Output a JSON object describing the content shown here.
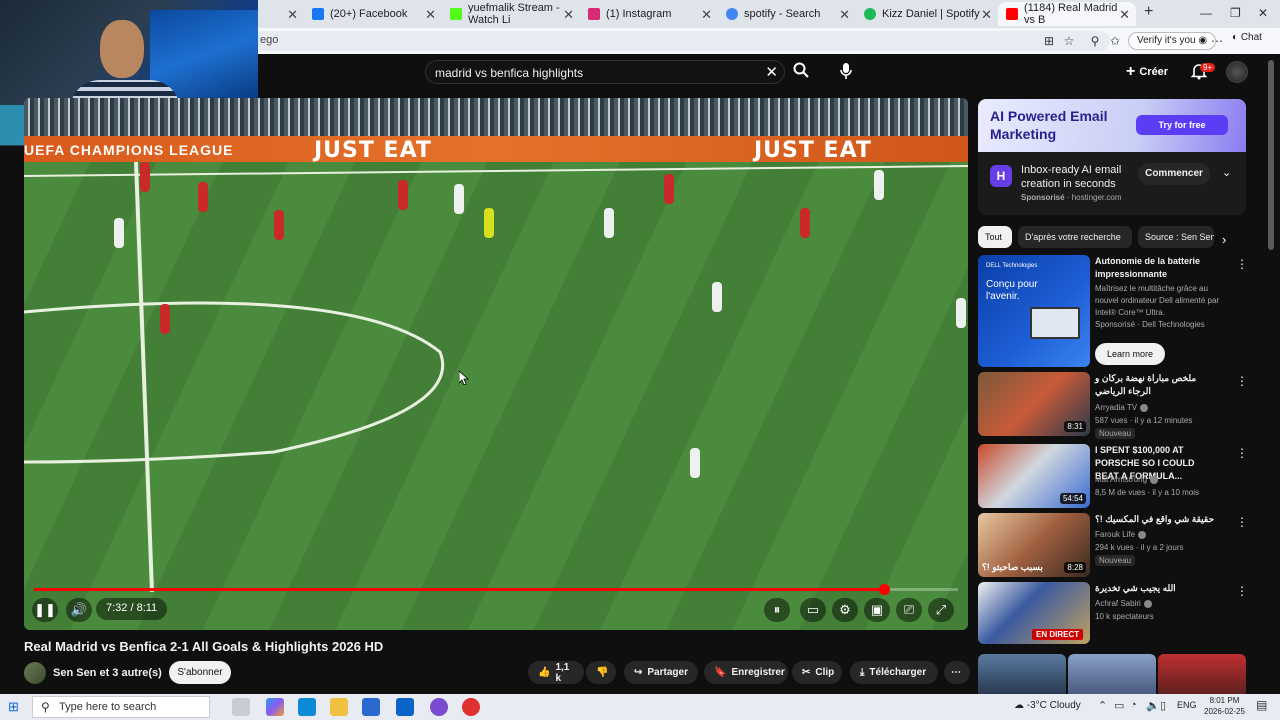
{
  "browser": {
    "tabs": [
      {
        "label": "(20+) Facebook",
        "fav": "#1877f2"
      },
      {
        "label": "yuefmalik Stream - Watch Li",
        "fav": "#53fc18"
      },
      {
        "label": "(1) Instagram",
        "fav": "#d62976"
      },
      {
        "label": "spotify - Search",
        "fav": "#4285f4"
      },
      {
        "label": "Kizz Daniel | Spotify",
        "fav": "#1db954"
      },
      {
        "label": "(1184) Real Madrid vs B",
        "fav": "#ff0000"
      }
    ],
    "url": "ego",
    "verify_label": "Verify it's you",
    "chat_label": "Chat",
    "new_tab": "+"
  },
  "youtube": {
    "search_value": "madrid vs benfica highlights",
    "create_label": "Créer",
    "notif_count": "9+"
  },
  "player": {
    "board_left": "UEFA CHAMPIONS LEAGUE",
    "board_ads": [
      "JUST EAT",
      "JUST EAT"
    ],
    "time": "7:32 / 8:11",
    "progress": 0.92
  },
  "video": {
    "title": "Real Madrid vs Benfica 2-1 All Goals & Highlights 2026 HD",
    "channel": "Sen Sen et 3 autre(s)",
    "subscribe": "S'abonner",
    "likes": "1,1 k",
    "share": "Partager",
    "save": "Enregistrer",
    "clip": "Clip",
    "download": "Télécharger"
  },
  "ad": {
    "headline": "AI Powered Email Marketing",
    "try": "Try for free",
    "desc": "Inbox-ready AI email creation in seconds",
    "sponsored": "Sponsorisé",
    "domain": "hostinger.com",
    "cta": "Commencer"
  },
  "chips": [
    "Tout",
    "D'après votre recherche",
    "Source : Sen Sen"
  ],
  "recs": [
    {
      "title": "Autonomie de la batterie impressionnante",
      "meta1": "Maîtrisez le multitâche grâce au nouvel ordinateur Dell alimenté par Intel® Core™ Ultra.",
      "meta2": "Sponsorisé · Dell Technologies",
      "cta": "Learn more",
      "thumb_text": "Conçu pour l'avenir.",
      "thumb_brand": "DELL Technologies"
    },
    {
      "title": "ملخص مباراة نهضة بركان و الرجاء الرياضي",
      "channel": "Arryadia TV",
      "stats": "587 vues · il y a 12 minutes",
      "badge": "Nouveau",
      "duration": "8:31"
    },
    {
      "title": "I SPENT $100,000 AT PORSCHE SO I COULD BEAT A FORMULA...",
      "channel": "Mat Armstrong",
      "stats": "8,5 M de vues · il y a 10 mois",
      "duration": "54:54"
    },
    {
      "title": "حقيقة شي واقع في المكسيك !؟",
      "channel": "Farouk Life",
      "stats": "294 k vues · il y a 2 jours",
      "badge": "Nouveau",
      "duration": "8:28",
      "thumb_text": "بسبب صاحبتو !؟"
    },
    {
      "title": "الله يجيب شي تخديرة",
      "channel": "Achraf Sabiri",
      "stats": "10 k spectateurs",
      "live": "EN DIRECT"
    }
  ],
  "taskbar": {
    "search_placeholder": "Type here to search",
    "weather": "-3°C  Cloudy",
    "lang": "ENG",
    "time": "8:01 PM",
    "date": "2026-02-25"
  }
}
